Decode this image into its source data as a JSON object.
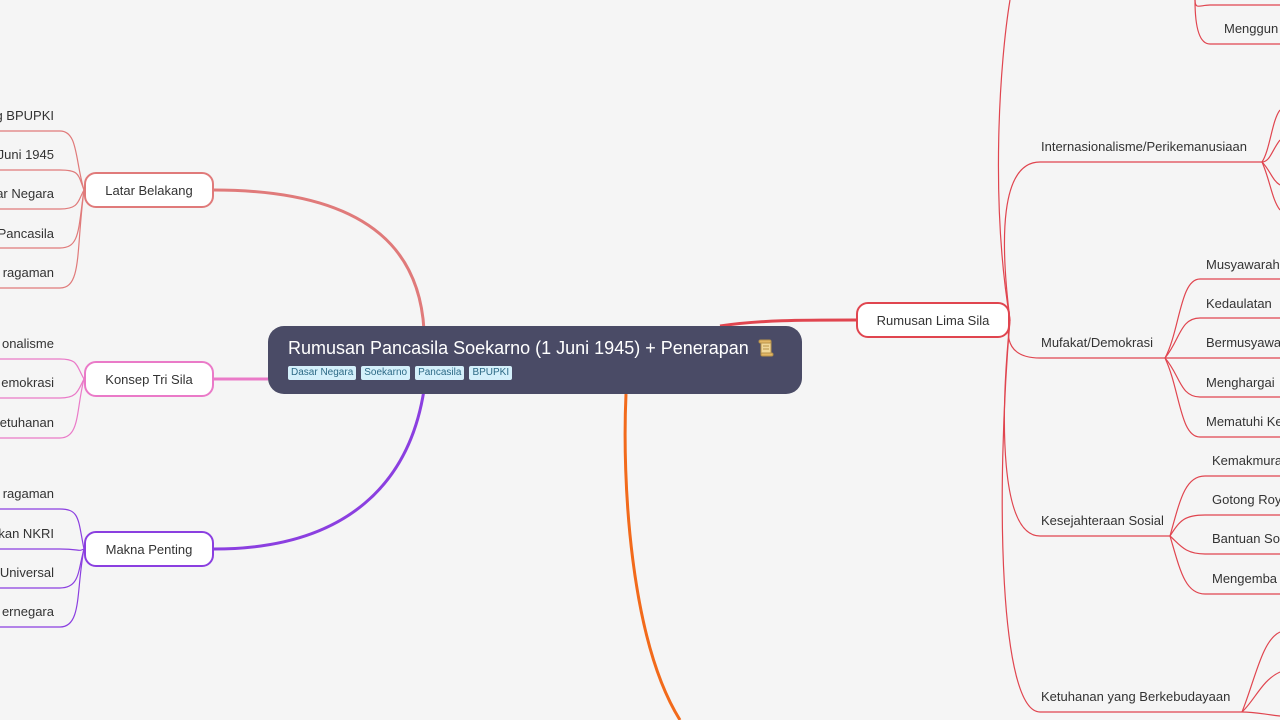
{
  "root": {
    "title": "Rumusan Pancasila Soekarno (1 Juni 1945) + Penerapan",
    "icon": "scroll-icon",
    "tags": [
      "Dasar Negara",
      "Soekarno",
      "Pancasila",
      "BPUPKI"
    ]
  },
  "left": {
    "latar": {
      "label": "Latar Belakang",
      "color": "#e07a7a",
      "children": [
        "g BPUPKI",
        "Juni 1945",
        "ar Negara",
        "Pancasila",
        "ragaman"
      ]
    },
    "konsep": {
      "label": "Konsep Tri Sila",
      "color": "#ea7ac8",
      "children": [
        "onalisme",
        "emokrasi",
        "etuhanan"
      ]
    },
    "makna": {
      "label": "Makna Penting",
      "color": "#8b3fe0",
      "children": [
        "ragaman",
        "kan NKRI",
        "Universal",
        "ernegara"
      ]
    }
  },
  "right": {
    "rumusan": {
      "label": "Rumusan Lima Sila",
      "color": "#e0454f",
      "top_child": "Menggun",
      "items": [
        {
          "label": "Internasionalisme/Perikemanusiaan",
          "children": []
        },
        {
          "label": "Mufakat/Demokrasi",
          "children": [
            "Musyawarah",
            "Kedaulatan",
            "Bermusyawa",
            "Menghargai",
            "Mematuhi Ke"
          ]
        },
        {
          "label": "Kesejahteraan Sosial",
          "children": [
            "Kemakmura",
            "Gotong Roy",
            "Bantuan So",
            "Mengemba"
          ]
        },
        {
          "label": "Ketuhanan yang Berkebudayaan",
          "children": []
        }
      ]
    }
  },
  "bottom_branch_color": "#f26a1b"
}
